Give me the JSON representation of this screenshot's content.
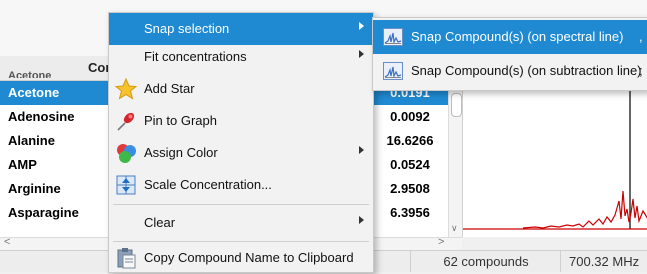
{
  "table": {
    "header": "Cor",
    "header_cut": "Acetone",
    "rows": [
      {
        "name": "Acetone",
        "conc": "0.0191",
        "selected": true
      },
      {
        "name": "Adenosine",
        "conc": "0.0092"
      },
      {
        "name": "Alanine",
        "conc": "16.6266"
      },
      {
        "name": "AMP",
        "conc": "0.0524"
      },
      {
        "name": "Arginine",
        "conc": "2.9508"
      },
      {
        "name": "Asparagine",
        "conc": "6.3956"
      }
    ]
  },
  "status": {
    "count": "62 compounds",
    "freq": "700.32 MHz"
  },
  "menu": {
    "items": [
      {
        "label": "Snap selection",
        "icon": "none",
        "submenu": true,
        "active": true
      },
      {
        "label": "Fit concentrations",
        "icon": "none",
        "submenu": true
      },
      {
        "label": "Add Star",
        "icon": "star-icon"
      },
      {
        "label": "Pin to Graph",
        "icon": "pushpin-icon"
      },
      {
        "label": "Assign Color",
        "icon": "color-balls-icon",
        "submenu": true
      },
      {
        "label": "Scale Concentration...",
        "icon": "scale-icon"
      },
      {
        "label": "Clear",
        "icon": "none",
        "submenu": true
      },
      {
        "label": "Copy Compound Name to Clipboard",
        "icon": "clipboard-icon"
      }
    ]
  },
  "submenu": {
    "items": [
      {
        "label": "Snap Compound(s) (on spectral line)",
        "trailing": ",",
        "icon": "spectrum-icon",
        "active": true
      },
      {
        "label": "Snap Compound(s) (on subtraction line)",
        "trailing": ";",
        "icon": "spectrum-icon"
      }
    ]
  },
  "colors": {
    "selection": "#1f8ad2",
    "spectrum_line": "#cc0000"
  }
}
